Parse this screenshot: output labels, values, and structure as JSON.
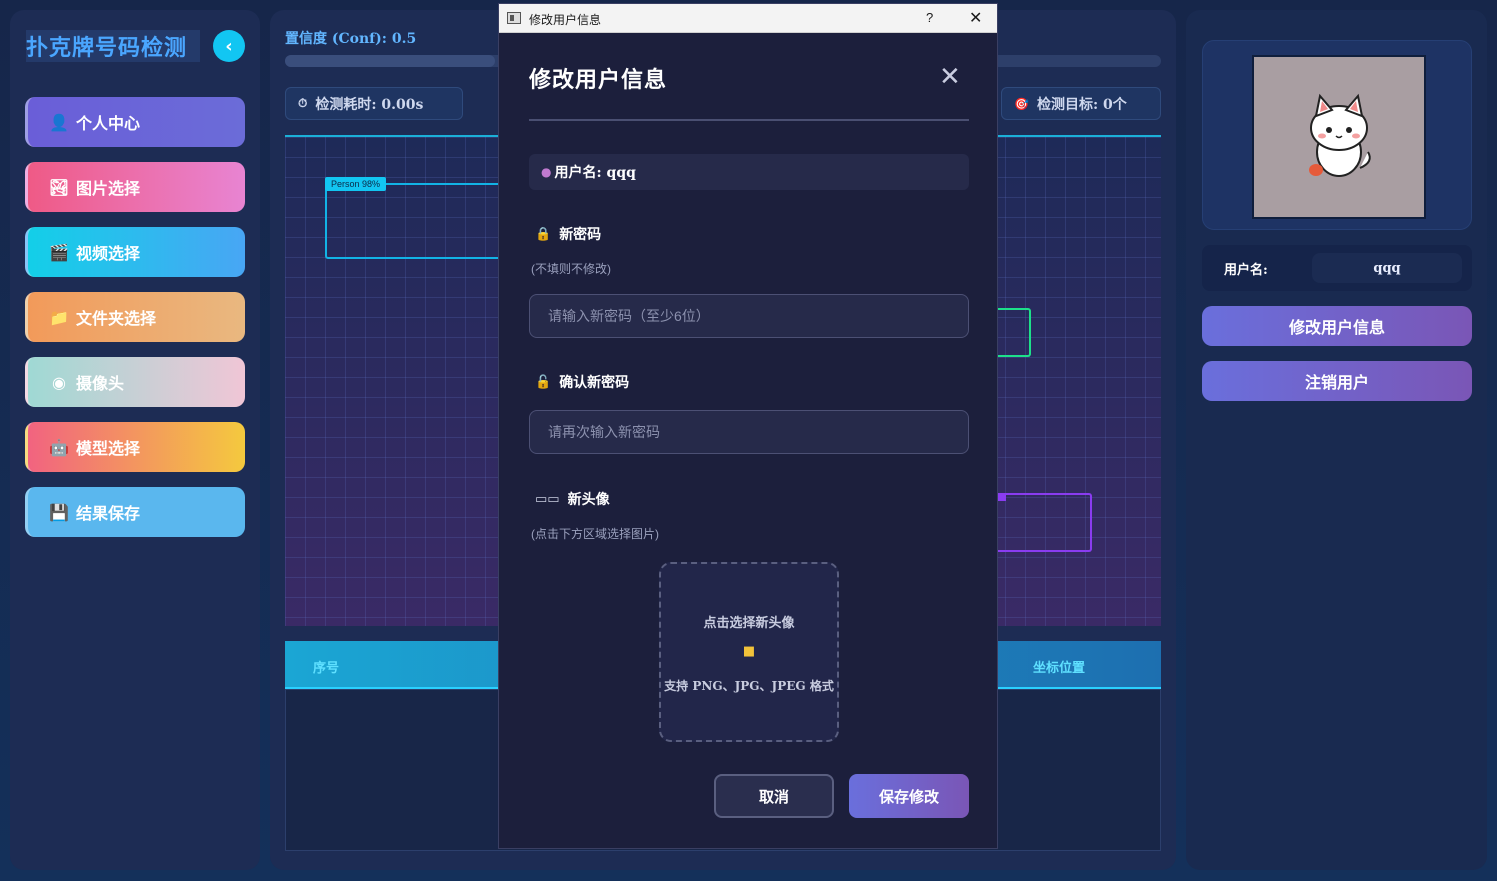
{
  "sidebar": {
    "app_title": "扑克牌号码检测",
    "collapse_icon": "chevron-left-icon",
    "items": [
      {
        "label": "个人中心",
        "icon": "user-icon",
        "glyph": "👤"
      },
      {
        "label": "图片选择",
        "icon": "image-icon",
        "glyph": "🏞"
      },
      {
        "label": "视频选择",
        "icon": "clapperboard-icon",
        "glyph": "🎬"
      },
      {
        "label": "文件夹选择",
        "icon": "folder-icon",
        "glyph": "📁"
      },
      {
        "label": "摄像头",
        "icon": "webcam-icon",
        "glyph": "◉"
      },
      {
        "label": "模型选择",
        "icon": "robot-icon",
        "glyph": "🤖"
      },
      {
        "label": "结果保存",
        "icon": "floppy-disk-icon",
        "glyph": "💾"
      }
    ]
  },
  "center": {
    "conf_label": "置信度 (Conf): 0.5",
    "conf_value": 0.5,
    "time_label": "检测耗时: 0.00s",
    "target_label": "检测目标: 0个",
    "detection_label": "Person 98%",
    "table": {
      "col_index": "序号",
      "col_position": "坐标位置"
    }
  },
  "right_panel": {
    "username_label": "用户名:",
    "username_value": "qqq",
    "edit_button": "修改用户信息",
    "logout_button": "注销用户"
  },
  "dialog": {
    "window_title": "修改用户信息",
    "help_glyph": "?",
    "close_glyph": "✕",
    "heading": "修改用户信息",
    "user_line": "用户名: qqq",
    "new_password_label": "新密码",
    "new_password_hint": "(不填则不修改)",
    "new_password_placeholder": "请输入新密码（至少6位）",
    "confirm_label": "确认新密码",
    "confirm_placeholder": "请再次输入新密码",
    "avatar_label": "新头像",
    "avatar_hint": "(点击下方区域选择图片)",
    "upload_title": "点击选择新头像",
    "upload_formats": "支持 PNG、JPG、JPEG 格式",
    "cancel_button": "取消",
    "save_button": "保存修改"
  },
  "colors": {
    "accent_cyan": "#12c6f2",
    "button_purple": "#6a6fdc",
    "panel_bg": "#1d2c54"
  }
}
